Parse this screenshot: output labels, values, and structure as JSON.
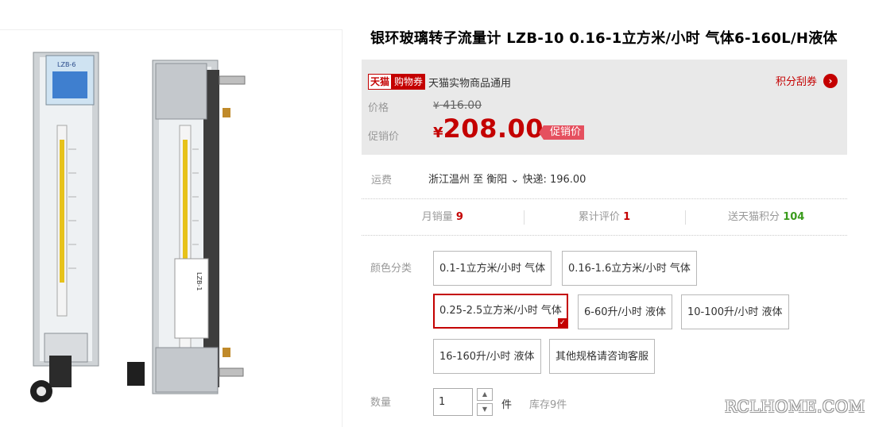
{
  "product": {
    "title": "银环玻璃转子流量计 LZB-10 0.16-1立方米/小时 气体6-160L/H液体"
  },
  "coupon": {
    "brand_tag": "天猫",
    "coupon_tag": "购物券",
    "description": "天猫实物商品通用",
    "points_link": "积分刮券",
    "points_arrow": "›"
  },
  "price": {
    "original_label": "价格",
    "currency": "¥",
    "original_value": "416.00",
    "promo_label": "促销价",
    "promo_value": "208.00",
    "promo_tag": "促销价"
  },
  "shipping": {
    "label": "运费",
    "text": "浙江温州  至  衡阳",
    "chevron": "⌄",
    "fee": "快递: 196.00"
  },
  "stats": [
    {
      "label": "月销量",
      "value": "9"
    },
    {
      "label": "累计评价",
      "value": "1"
    },
    {
      "label": "送天猫积分",
      "value": "104"
    }
  ],
  "sku": {
    "label": "颜色分类",
    "options": [
      "0.1-1立方米/小时 气体",
      "0.16-1.6立方米/小时 气体",
      "0.25-2.5立方米/小时 气体",
      "6-60升/小时 液体",
      "10-100升/小时 液体",
      "16-160升/小时 液体",
      "其他规格请咨询客服"
    ],
    "selected_index": 2
  },
  "quantity": {
    "label": "数量",
    "value": "1",
    "unit": "件",
    "stock": "库存9件",
    "up": "▲",
    "down": "▼"
  },
  "image_text": {
    "meter_left_label": "LZB-6",
    "meter_right_label": "LZB-1"
  },
  "watermark": "RCLHOME.COM",
  "colors": {
    "accent": "#c40000",
    "price_box_bg": "#e9e9e9",
    "green": "#3b9b1d"
  }
}
